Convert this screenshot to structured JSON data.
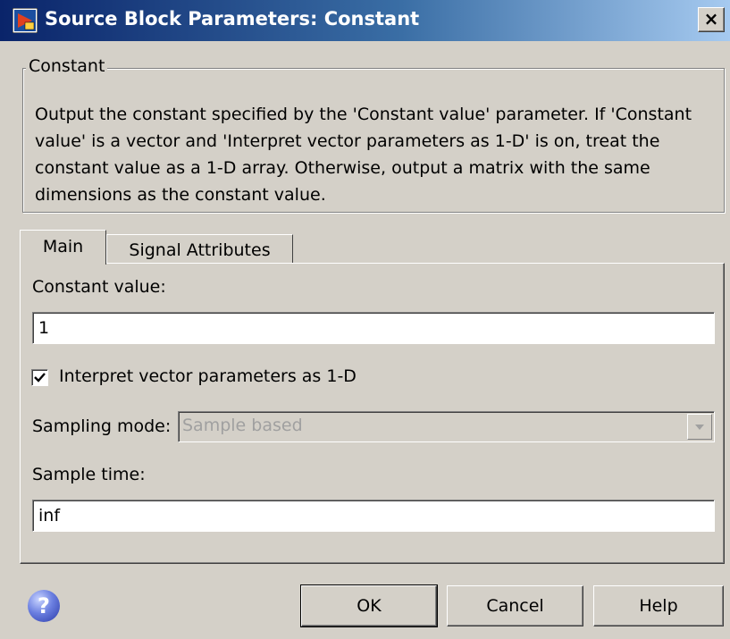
{
  "window": {
    "title": "Source Block Parameters: Constant",
    "close_glyph": "×",
    "icon": "simulink-block-icon",
    "accent_color": "#0a246a"
  },
  "group": {
    "legend": "Constant",
    "description": "Output the constant specified by the 'Constant value' parameter. If 'Constant value' is a vector and 'Interpret vector parameters as 1-D' is on, treat the constant value as a 1-D array. Otherwise, output a matrix with the same dimensions as the constant value."
  },
  "tabs": [
    {
      "label": "Main",
      "selected": true
    },
    {
      "label": "Signal Attributes",
      "selected": false
    }
  ],
  "main": {
    "constant_value_label": "Constant value:",
    "constant_value": "1",
    "interpret_checkbox_label": "Interpret vector parameters as 1-D",
    "interpret_checked": true,
    "sampling_mode_label": "Sampling mode:",
    "sampling_mode_value": "Sample based",
    "sample_time_label": "Sample time:",
    "sample_time_value": "inf"
  },
  "buttons": {
    "help_icon": "?",
    "ok": "OK",
    "cancel": "Cancel",
    "help": "Help"
  }
}
